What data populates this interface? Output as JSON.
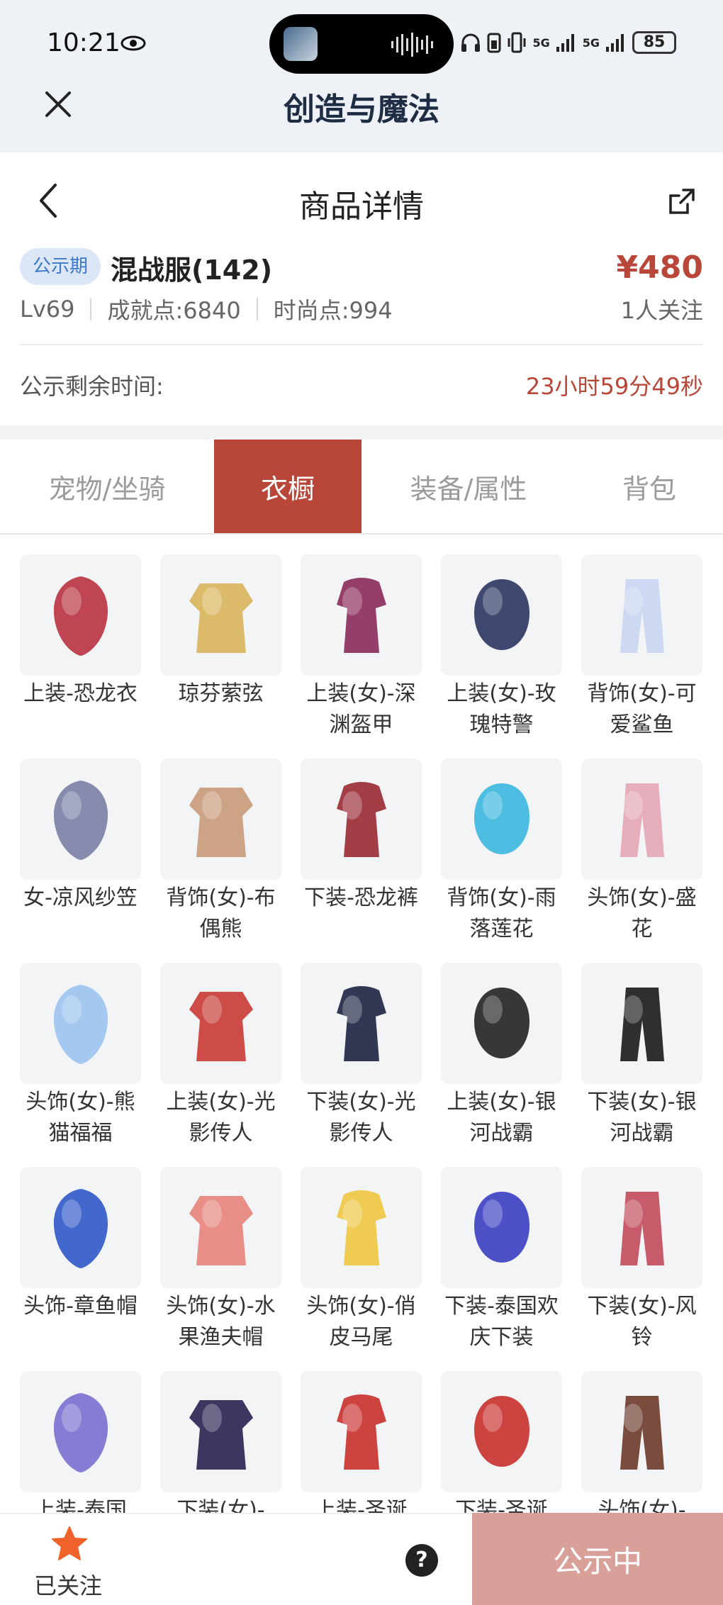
{
  "status": {
    "time": "10:21",
    "network": "5G",
    "battery": "85"
  },
  "app": {
    "title": "创造与魔法"
  },
  "nav": {
    "title": "商品详情"
  },
  "product": {
    "badge": "公示期",
    "name": "混战服(142)",
    "price": "¥480",
    "level": "Lv69",
    "achievement": "成就点:6840",
    "fashion": "时尚点:994",
    "followers": "1人关注",
    "remain_label": "公示剩余时间:",
    "remain_value": "23小时59分49秒"
  },
  "tabs": [
    {
      "label": "宠物/坐骑",
      "active": false
    },
    {
      "label": "衣橱",
      "active": true
    },
    {
      "label": "装备/属性",
      "active": false
    },
    {
      "label": "背包",
      "active": false
    }
  ],
  "items": [
    {
      "name": "上装-恐龙衣",
      "icon": "dino-top-icon",
      "color": "#b8323f"
    },
    {
      "name": "琼芬萦弦",
      "icon": "golden-bow-icon",
      "color": "#d8b45a"
    },
    {
      "name": "上装(女)-深渊盔甲",
      "icon": "abyss-armor-icon",
      "color": "#8a2a5a"
    },
    {
      "name": "上装(女)-玫瑰特警",
      "icon": "rose-police-icon",
      "color": "#2b3660"
    },
    {
      "name": "背饰(女)-可爱鲨鱼",
      "icon": "shark-back-icon",
      "color": "#c9d6f2"
    },
    {
      "name": "女-凉风纱笠",
      "icon": "veil-hat-icon",
      "color": "#7a7fa6"
    },
    {
      "name": "背饰(女)-布偶熊",
      "icon": "teddy-bear-icon",
      "color": "#c99a7a"
    },
    {
      "name": "下装-恐龙裤",
      "icon": "dino-pants-icon",
      "color": "#9a2a34"
    },
    {
      "name": "背饰(女)-雨落莲花",
      "icon": "lotus-umbrella-icon",
      "color": "#3bb7e0"
    },
    {
      "name": "头饰(女)-盛花",
      "icon": "flower-hair-icon",
      "color": "#e3a6b4"
    },
    {
      "name": "头饰(女)-熊猫福福",
      "icon": "panda-hat-icon",
      "color": "#9cc3ef"
    },
    {
      "name": "上装(女)-光影传人",
      "icon": "red-jacket-icon",
      "color": "#c93a34"
    },
    {
      "name": "下装(女)-光影传人",
      "icon": "navy-skirt-icon",
      "color": "#1d2442"
    },
    {
      "name": "上装(女)-银河战霸",
      "icon": "black-top-icon",
      "color": "#222222"
    },
    {
      "name": "下装(女)-银河战霸",
      "icon": "black-skirt-icon",
      "color": "#1a1a1a"
    },
    {
      "name": "头饰-章鱼帽",
      "icon": "octopus-hat-icon",
      "color": "#2f58c9"
    },
    {
      "name": "头饰(女)-水果渔夫帽",
      "icon": "fruit-bucket-hat-icon",
      "color": "#e8837a"
    },
    {
      "name": "头饰(女)-俏皮马尾",
      "icon": "ponytail-icon",
      "color": "#f0c640"
    },
    {
      "name": "下装-泰国欢庆下装",
      "icon": "thai-pants-icon",
      "color": "#3a3fc2"
    },
    {
      "name": "下装(女)-风铃",
      "icon": "windbell-boots-icon",
      "color": "#c24a5a"
    },
    {
      "name": "上装-泰国",
      "icon": "thai-top-icon",
      "color": "#7a6fd0"
    },
    {
      "name": "下装(女)-",
      "icon": "purple-boots-icon",
      "color": "#2a2050"
    },
    {
      "name": "上装-圣诞",
      "icon": "xmas-top-icon",
      "color": "#c9302c"
    },
    {
      "name": "下装-圣诞",
      "icon": "xmas-boots-icon",
      "color": "#c9302c"
    },
    {
      "name": "头饰(女)-",
      "icon": "brown-hair-icon",
      "color": "#6b3a2a"
    }
  ],
  "footer": {
    "followed": "已关注",
    "help": "?",
    "cta": "公示中"
  }
}
